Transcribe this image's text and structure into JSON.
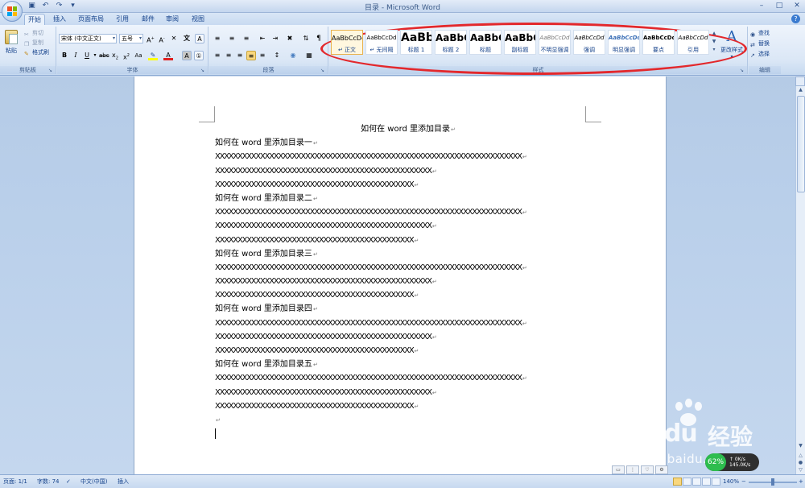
{
  "window": {
    "title": "目录 - Microsoft Word"
  },
  "tabs": [
    {
      "label": "开始",
      "active": true
    },
    {
      "label": "插入"
    },
    {
      "label": "页面布局"
    },
    {
      "label": "引用"
    },
    {
      "label": "邮件"
    },
    {
      "label": "审阅"
    },
    {
      "label": "视图"
    }
  ],
  "ribbon": {
    "clipboard": {
      "label": "剪贴板",
      "paste": "粘贴",
      "cut": "剪切",
      "copy": "复制",
      "format_painter": "格式刷"
    },
    "font": {
      "label": "字体",
      "font_name": "宋体 (中文正文)",
      "font_size": "五号",
      "font_color": "#e02020",
      "highlight_color": "#ffff00"
    },
    "paragraph": {
      "label": "段落"
    },
    "styles": {
      "label": "样式",
      "items": [
        {
          "sample": "AaBbCcDd",
          "name": "↵ 正文",
          "selected": true
        },
        {
          "sample": "AaBbCcDd",
          "name": "↵ 无间隔"
        },
        {
          "sample": "AaBb",
          "name": "标题 1"
        },
        {
          "sample": "AaBbC",
          "name": "标题 2"
        },
        {
          "sample": "AaBbC",
          "name": "标题"
        },
        {
          "sample": "AaBbC",
          "name": "副标题"
        },
        {
          "sample": "AaBbCcDd",
          "name": "不明显强调"
        },
        {
          "sample": "AaBbCcDd",
          "name": "强调"
        },
        {
          "sample": "AaBbCcDd",
          "name": "明显强调"
        },
        {
          "sample": "AaBbCcDd",
          "name": "要点"
        },
        {
          "sample": "AaBbCcDd",
          "name": "引用"
        }
      ],
      "change_styles": "更改样式",
      "highlight_color": "#e3282c"
    },
    "editing": {
      "label": "编辑",
      "find": "查找",
      "replace": "替换",
      "select": "选择"
    }
  },
  "document": {
    "title_line": "如何在 word 里添加目录",
    "sections": [
      {
        "heading": "如何在 word 里添加目录一",
        "lines": [
          "XXXXXXXXXXXXXXXXXXXXXXXXXXXXXXXXXXXXXXXXXXXXXXXXXXXXXXXXXXXXXXXXXXXX",
          "XXXXXXXXXXXXXXXXXXXXXXXXXXXXXXXXXXXXXXXXXXXXXXXX",
          "XXXXXXXXXXXXXXXXXXXXXXXXXXXXXXXXXXXXXXXXXXXX"
        ]
      },
      {
        "heading": "如何在 word 里添加目录二",
        "lines": [
          "XXXXXXXXXXXXXXXXXXXXXXXXXXXXXXXXXXXXXXXXXXXXXXXXXXXXXXXXXXXXXXXXXXXX",
          "XXXXXXXXXXXXXXXXXXXXXXXXXXXXXXXXXXXXXXXXXXXXXXXX",
          "XXXXXXXXXXXXXXXXXXXXXXXXXXXXXXXXXXXXXXXXXXXX"
        ]
      },
      {
        "heading": "如何在 word 里添加目录三",
        "lines": [
          "XXXXXXXXXXXXXXXXXXXXXXXXXXXXXXXXXXXXXXXXXXXXXXXXXXXXXXXXXXXXXXXXXXXX",
          "XXXXXXXXXXXXXXXXXXXXXXXXXXXXXXXXXXXXXXXXXXXXXXXX",
          "XXXXXXXXXXXXXXXXXXXXXXXXXXXXXXXXXXXXXXXXXXXX"
        ]
      },
      {
        "heading": "如何在 word 里添加目录四",
        "lines": [
          "XXXXXXXXXXXXXXXXXXXXXXXXXXXXXXXXXXXXXXXXXXXXXXXXXXXXXXXXXXXXXXXXXXXX",
          "XXXXXXXXXXXXXXXXXXXXXXXXXXXXXXXXXXXXXXXXXXXXXXXX",
          "XXXXXXXXXXXXXXXXXXXXXXXXXXXXXXXXXXXXXXXXXXXX"
        ]
      },
      {
        "heading": "如何在 word 里添加目录五",
        "lines": [
          "XXXXXXXXXXXXXXXXXXXXXXXXXXXXXXXXXXXXXXXXXXXXXXXXXXXXXXXXXXXXXXXXXXXX",
          "XXXXXXXXXXXXXXXXXXXXXXXXXXXXXXXXXXXXXXXXXXXXXXXX",
          "XXXXXXXXXXXXXXXXXXXXXXXXXXXXXXXXXXXXXXXXXXXX"
        ]
      }
    ],
    "paragraph_mark": "↵"
  },
  "status": {
    "page": "页面: 1/1",
    "words": "字数: 74",
    "language": "中文(中国)",
    "mode": "插入",
    "zoom": "140%"
  },
  "watermark": {
    "logo": "Bai du",
    "brand": "经验",
    "url": "jingyan.baidu.com"
  },
  "net_badge": {
    "percent": "62",
    "speed": "145.0K/s"
  }
}
